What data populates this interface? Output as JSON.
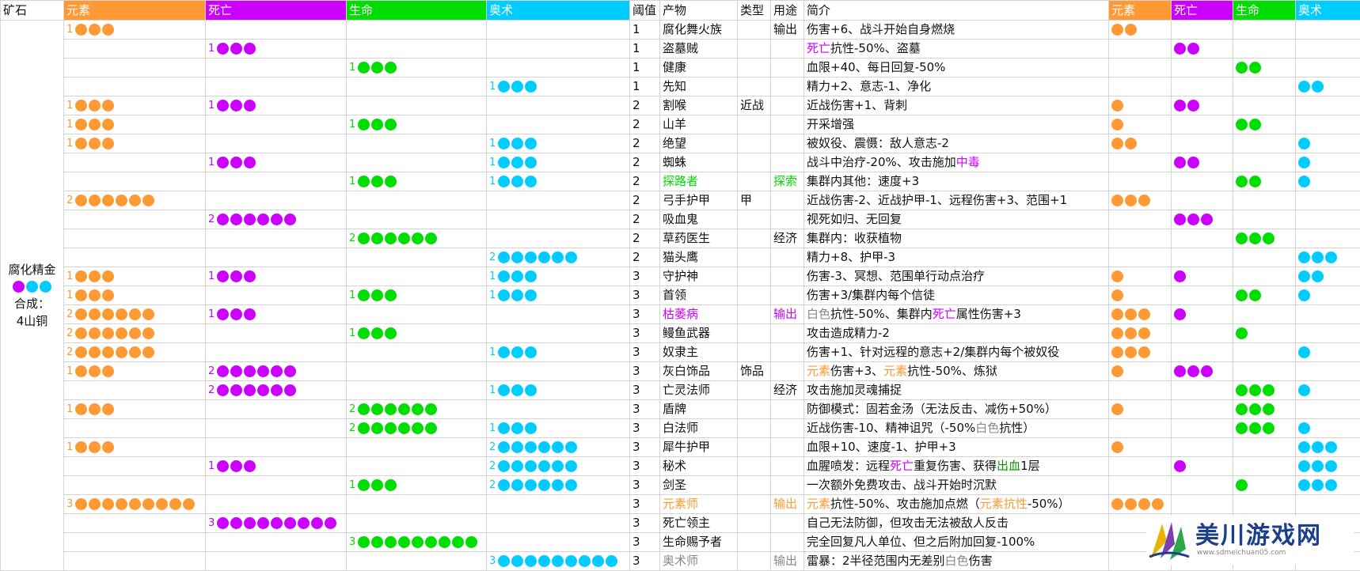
{
  "colors": {
    "elem": "#ff9933",
    "death": "#cc00ff",
    "life": "#00dd00",
    "arcane": "#00ccff",
    "rowbg": "#ffffff",
    "text": "#111111",
    "white_word": "#888888",
    "blood_word": "#009900"
  },
  "headers": {
    "ore": "矿石",
    "elem": "元素",
    "death": "死亡",
    "life": "生命",
    "arcane": "奥术",
    "threshold": "阈值",
    "product": "产物",
    "type": "类型",
    "use": "用途",
    "desc": "简介",
    "elem2": "元素",
    "death2": "死亡",
    "life2": "生命",
    "arcane2": "奥术"
  },
  "ore": {
    "name": "腐化精金",
    "dots": [
      "death",
      "arcane",
      "arcane"
    ],
    "synth_label": "合成：",
    "synth_value": "4山铜"
  },
  "rows": [
    {
      "req": {
        "elem": 1
      },
      "threshold": "1",
      "product": "腐化舞火族",
      "type": "",
      "use": "输出",
      "desc": [
        [
          "伤害+6、战斗开始自身燃烧",
          ""
        ]
      ],
      "out": {
        "elem": 2
      }
    },
    {
      "req": {
        "death": 1
      },
      "threshold": "1",
      "product": "盗墓贼",
      "type": "",
      "use": "",
      "desc": [
        [
          "死亡",
          "death"
        ],
        [
          "抗性-50%、盗墓",
          ""
        ]
      ],
      "out": {
        "death": 2
      }
    },
    {
      "req": {
        "life": 1
      },
      "threshold": "1",
      "product": "健康",
      "type": "",
      "use": "",
      "desc": [
        [
          "血限+40、每日回复-50%",
          ""
        ]
      ],
      "out": {
        "life": 2
      }
    },
    {
      "req": {
        "arcane": 1
      },
      "threshold": "1",
      "product": "先知",
      "type": "",
      "use": "",
      "desc": [
        [
          "精力+2、意志-1、净化",
          ""
        ]
      ],
      "out": {
        "arcane": 2
      }
    },
    {
      "req": {
        "elem": 1,
        "death": 1
      },
      "threshold": "2",
      "product": "割喉",
      "type": "近战",
      "use": "",
      "desc": [
        [
          "近战伤害+1、背刺",
          ""
        ]
      ],
      "out": {
        "elem": 1,
        "death": 2
      }
    },
    {
      "req": {
        "elem": 1,
        "life": 1
      },
      "threshold": "2",
      "product": "山羊",
      "type": "",
      "use": "",
      "desc": [
        [
          "开采增强",
          ""
        ]
      ],
      "out": {
        "elem": 1,
        "life": 2
      }
    },
    {
      "req": {
        "elem": 1,
        "arcane": 1
      },
      "threshold": "2",
      "product": "绝望",
      "type": "",
      "use": "",
      "desc": [
        [
          "被奴役、震慑：敌人意志-2",
          ""
        ]
      ],
      "out": {
        "elem": 2,
        "arcane": 1
      }
    },
    {
      "req": {
        "death": 1,
        "arcane": 1
      },
      "threshold": "2",
      "product": "蜘蛛",
      "type": "",
      "use": "",
      "desc": [
        [
          "战斗中治疗-20%、攻击施加",
          ""
        ],
        [
          "中毒",
          "death"
        ]
      ],
      "out": {
        "death": 2,
        "arcane": 1
      }
    },
    {
      "req": {
        "life": 1,
        "arcane": 1
      },
      "threshold": "2",
      "product": "探路者",
      "productColor": "life",
      "type": "",
      "use": "探索",
      "useColor": "life",
      "desc": [
        [
          "集群内其他：速度+3",
          ""
        ]
      ],
      "out": {
        "life": 2,
        "arcane": 1
      }
    },
    {
      "req": {
        "elem": 2
      },
      "threshold": "2",
      "product": "弓手护甲",
      "type": "甲",
      "use": "",
      "desc": [
        [
          "近战伤害-2、近战护甲-1、远程伤害+3、范围+1",
          ""
        ]
      ],
      "out": {
        "elem": 3
      }
    },
    {
      "req": {
        "death": 2
      },
      "threshold": "2",
      "product": "吸血鬼",
      "type": "",
      "use": "",
      "desc": [
        [
          "视死如归、无回复",
          ""
        ]
      ],
      "out": {
        "death": 3
      }
    },
    {
      "req": {
        "life": 2
      },
      "threshold": "2",
      "product": "草药医生",
      "type": "",
      "use": "经济",
      "desc": [
        [
          "集群内：收获植物",
          ""
        ]
      ],
      "out": {
        "life": 3
      }
    },
    {
      "req": {
        "arcane": 2
      },
      "threshold": "2",
      "product": "猫头鹰",
      "type": "",
      "use": "",
      "desc": [
        [
          "精力+8、护甲-3",
          ""
        ]
      ],
      "out": {
        "arcane": 3
      }
    },
    {
      "req": {
        "elem": 1,
        "death": 1,
        "arcane": 1
      },
      "threshold": "3",
      "product": "守护神",
      "type": "",
      "use": "",
      "desc": [
        [
          "伤害-3、冥想、范围单行动点治疗",
          ""
        ]
      ],
      "out": {
        "elem": 1,
        "death": 1,
        "arcane": 2
      }
    },
    {
      "req": {
        "elem": 1,
        "life": 1,
        "arcane": 1
      },
      "threshold": "3",
      "product": "首领",
      "type": "",
      "use": "",
      "desc": [
        [
          "伤害+3/集群内每个信徒",
          ""
        ]
      ],
      "out": {
        "elem": 1,
        "life": 2,
        "arcane": 1
      }
    },
    {
      "req": {
        "elem": 2,
        "death": 1
      },
      "threshold": "3",
      "product": "枯萎病",
      "productColor": "death",
      "type": "",
      "use": "输出",
      "useColor": "death",
      "desc": [
        [
          "白色",
          "white"
        ],
        [
          "抗性-50%、集群内",
          ""
        ],
        [
          "死亡",
          "death"
        ],
        [
          "属性伤害+3",
          ""
        ]
      ],
      "out": {
        "elem": 3,
        "death": 1
      }
    },
    {
      "req": {
        "elem": 2,
        "life": 1
      },
      "threshold": "3",
      "product": "鳗鱼武器",
      "type": "",
      "use": "",
      "desc": [
        [
          "攻击造成精力-2",
          ""
        ]
      ],
      "out": {
        "elem": 3,
        "life": 1
      }
    },
    {
      "req": {
        "elem": 2,
        "arcane": 1
      },
      "threshold": "3",
      "product": "奴隶主",
      "type": "",
      "use": "",
      "desc": [
        [
          "伤害+1、针对远程的意志+2/集群内每个被奴役",
          ""
        ]
      ],
      "out": {
        "elem": 3,
        "arcane": 1
      }
    },
    {
      "req": {
        "elem": 1,
        "death": 2
      },
      "threshold": "3",
      "product": "灰白饰品",
      "type": "饰品",
      "use": "",
      "desc": [
        [
          "元素",
          "elem"
        ],
        [
          "伤害+3、",
          ""
        ],
        [
          "元素",
          "elem"
        ],
        [
          "抗性-50%、炼狱",
          ""
        ]
      ],
      "out": {
        "elem": 1,
        "death": 3
      }
    },
    {
      "req": {
        "death": 2,
        "arcane": 1
      },
      "threshold": "3",
      "product": "亡灵法师",
      "type": "",
      "use": "经济",
      "desc": [
        [
          "攻击施加灵魂捕捉",
          ""
        ]
      ],
      "out": {
        "life": 3,
        "arcane": 1
      }
    },
    {
      "req": {
        "elem": 1,
        "life": 2
      },
      "threshold": "3",
      "product": "盾牌",
      "type": "",
      "use": "",
      "desc": [
        [
          "防御模式：固若金汤（无法反击、减伤+50%）",
          ""
        ]
      ],
      "out": {
        "elem": 1,
        "life": 3
      }
    },
    {
      "req": {
        "life": 2,
        "arcane": 1
      },
      "threshold": "3",
      "product": "白法师",
      "type": "",
      "use": "",
      "desc": [
        [
          "近战伤害-10、精神诅咒（-50%",
          ""
        ],
        [
          "白色",
          "white"
        ],
        [
          "抗性）",
          ""
        ]
      ],
      "out": {
        "life": 3,
        "arcane": 1
      }
    },
    {
      "req": {
        "elem": 1,
        "arcane": 2
      },
      "threshold": "3",
      "product": "犀牛护甲",
      "type": "",
      "use": "",
      "desc": [
        [
          "血限+10、速度-1、护甲+3",
          ""
        ]
      ],
      "out": {
        "elem": 1,
        "arcane": 3
      }
    },
    {
      "req": {
        "death": 1,
        "arcane": 2
      },
      "threshold": "3",
      "product": "秘术",
      "type": "",
      "use": "",
      "desc": [
        [
          "血腥喷发：远程",
          ""
        ],
        [
          "死亡",
          "death"
        ],
        [
          "重复伤害、获得",
          ""
        ],
        [
          "出血",
          "blood"
        ],
        [
          "1层",
          ""
        ]
      ],
      "out": {
        "death": 1,
        "arcane": 3
      }
    },
    {
      "req": {
        "life": 1,
        "arcane": 2
      },
      "threshold": "3",
      "product": "剑圣",
      "type": "",
      "use": "",
      "desc": [
        [
          "一次额外免费攻击、战斗开始时沉默",
          ""
        ]
      ],
      "out": {
        "life": 1,
        "arcane": 3
      }
    },
    {
      "req": {
        "elem": 3
      },
      "threshold": "3",
      "product": "元素师",
      "productColor": "elem",
      "type": "",
      "use": "输出",
      "useColor": "elem",
      "desc": [
        [
          "元素",
          "elem"
        ],
        [
          "抗性-50%、攻击施加点燃（",
          ""
        ],
        [
          "元素",
          "elem"
        ],
        [
          "抗性",
          "elem"
        ],
        [
          "-50%）",
          ""
        ]
      ],
      "out": {
        "elem": 4
      }
    },
    {
      "req": {
        "death": 3
      },
      "threshold": "3",
      "product": "死亡领主",
      "type": "",
      "use": "",
      "desc": [
        [
          "自己无法防御，但攻击无法被敌人反击",
          ""
        ]
      ],
      "out": {}
    },
    {
      "req": {
        "life": 3
      },
      "threshold": "3",
      "product": "生命赐予者",
      "type": "",
      "use": "",
      "desc": [
        [
          "完全回复凡人单位、但之后附加回复-100%",
          ""
        ]
      ],
      "out": {}
    },
    {
      "req": {
        "arcane": 3
      },
      "threshold": "3",
      "product": "奥术师",
      "productColor": "gray",
      "type": "",
      "use": "输出",
      "useColor": "gray",
      "desc": [
        [
          "雷暴：2半径范围内无差别",
          ""
        ],
        [
          "白色",
          "white"
        ],
        [
          "伤害",
          ""
        ]
      ],
      "out": {}
    }
  ],
  "watermark": {
    "title": "美川游戏网",
    "url": "www.sdmeichuan05.com"
  }
}
